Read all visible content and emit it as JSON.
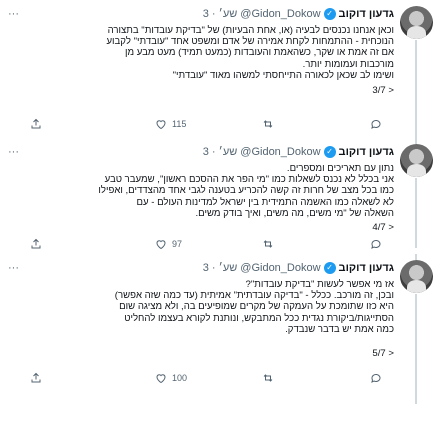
{
  "tweets": [
    {
      "name": "גדעון דוקוב",
      "handle": "@Gidon_Dokow",
      "time": "3 · שע׳",
      "text": "וכאן אנחנו נכנסים לבעיה (או, אחת הבעיות) של \"בדיקת עובדות\" בתצורה\nהנוכחית - ההתמחות לקחת אמירה של אדם ומשפט אחד \"עובדתי\" לקבוע\nאם זה אמת או שקר, כשהאמת והעובדות (כמעט תמיד) מעט מבע מן\nמורכבות ועמומות יותר.\nושימו לב שכאן לכאורה התייחסתי למשהו מאוד \"עובדתי\"",
      "counter": "3/7 >",
      "likes": "115"
    },
    {
      "name": "גדעון דוקוב",
      "handle": "@Gidon_Dokow",
      "time": "3 · שע׳",
      "text": "נתון עם תאריכים ומספרים.\nאני בכלל לא נכנס לשאלות כמו \"מי הפר את ההסכם ראשון\", שמעבר טבע\nכמו בכל מצב של חרות זה קשה להכריע בטענה לגבי אחד מהצדדים, ואפילו\nלא לשאלה כמו האשמה התמידית בין ישראל למדינות העולם - עם\nהשאלה של \"מי משים, מה משים, ואיך בודק משים.",
      "counter": "4/7 >",
      "likes": "97"
    },
    {
      "name": "גדעון דוקוב",
      "handle": "@Gidon_Dokow",
      "time": "3 · שע׳",
      "text": "אז מי אפשר לעשות \"בדיקת עובדות\"?\nובכן, זה מורכב. ככלל - \"בדיקה עובדתית\" אמיתית (עד כמה שזה אפשר)\nהיא כזו שתומכת על העמקה של מקרים שמופיעים בה, ולא מציגה שום\nהסתייגות/ביקורת נגדית ככל המתבקש, ונותנת לקורא בעצמו להחליט\nכמה אמת יש בדבר שנבדק.",
      "counter": "5/7 >",
      "likes": "100"
    }
  ]
}
